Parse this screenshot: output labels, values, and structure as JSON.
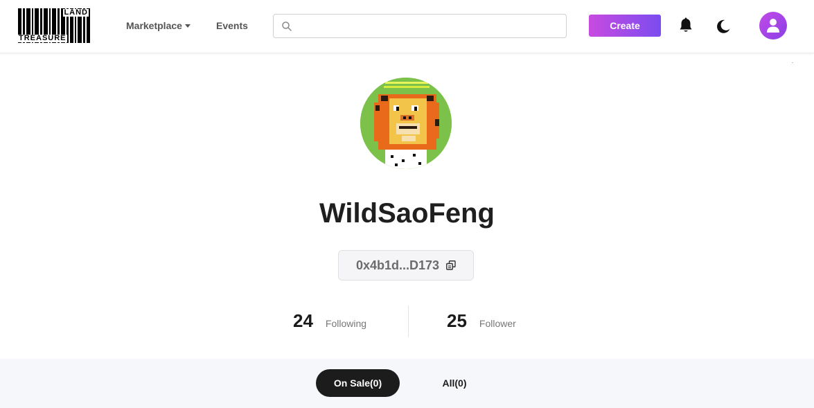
{
  "header": {
    "logo": {
      "text_top": "LAND",
      "text_bottom": "TREASURE",
      "alt": "Treasureland logo"
    },
    "nav": [
      {
        "label": "Marketplace",
        "has_dropdown": true
      },
      {
        "label": "Events"
      }
    ],
    "search": {
      "placeholder": "",
      "value": ""
    },
    "create_label": "Create",
    "icons": [
      "search-icon",
      "bell-icon",
      "moon-icon",
      "user-icon"
    ]
  },
  "profile": {
    "username": "WildSaoFeng",
    "address": "0x4b1d...D173",
    "following_count": "24",
    "following_label": "Following",
    "follower_count": "25",
    "follower_label": "Follower"
  },
  "tabs": [
    {
      "label": "On Sale(0)",
      "active": true
    },
    {
      "label": "All(0)",
      "active": false
    }
  ],
  "colors": {
    "create_gradient_start": "#c84be0",
    "create_gradient_end": "#7b4cf0",
    "avatar_bg": "#7cc24a",
    "active_tab_bg": "#1c1c1c",
    "tab_strip_bg": "#f6f7fb"
  }
}
